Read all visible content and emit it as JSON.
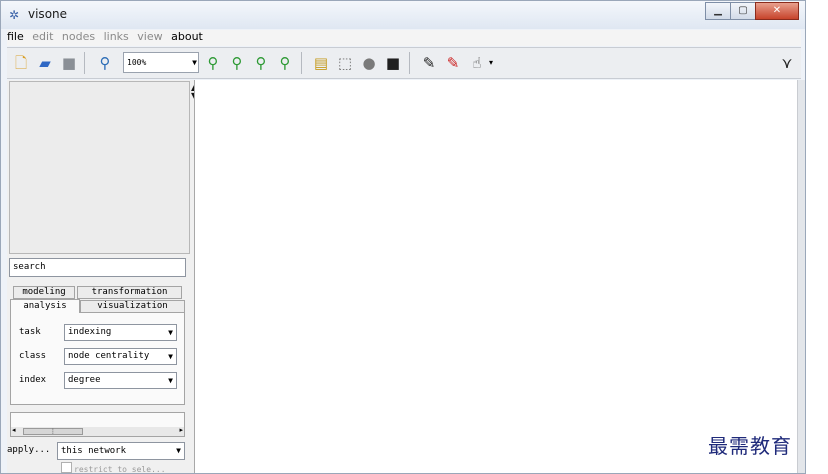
{
  "window": {
    "title": "visone"
  },
  "menu": [
    {
      "label": "file",
      "active": true
    },
    {
      "label": "edit",
      "active": false
    },
    {
      "label": "nodes",
      "active": false
    },
    {
      "label": "links",
      "active": false
    },
    {
      "label": "view",
      "active": false
    },
    {
      "label": "about",
      "active": true
    }
  ],
  "toolbar": {
    "zoom_value": "100%"
  },
  "panel": {
    "search_value": "search",
    "tabs": {
      "modeling": "modeling",
      "transformation": "transformation",
      "analysis": "analysis",
      "visualization": "visualization"
    },
    "fields": {
      "task_label": "task",
      "task_value": "indexing",
      "class_label": "class",
      "class_value": "node centrality",
      "index_label": "index",
      "index_value": "degree"
    },
    "apply_label": "apply...",
    "apply_value": "this network",
    "restrict_label": "restrict to sele..."
  },
  "watermark": "最需教育",
  "colors": {
    "window_frame": "#9aa7b9",
    "close_button": "#c7432b"
  }
}
